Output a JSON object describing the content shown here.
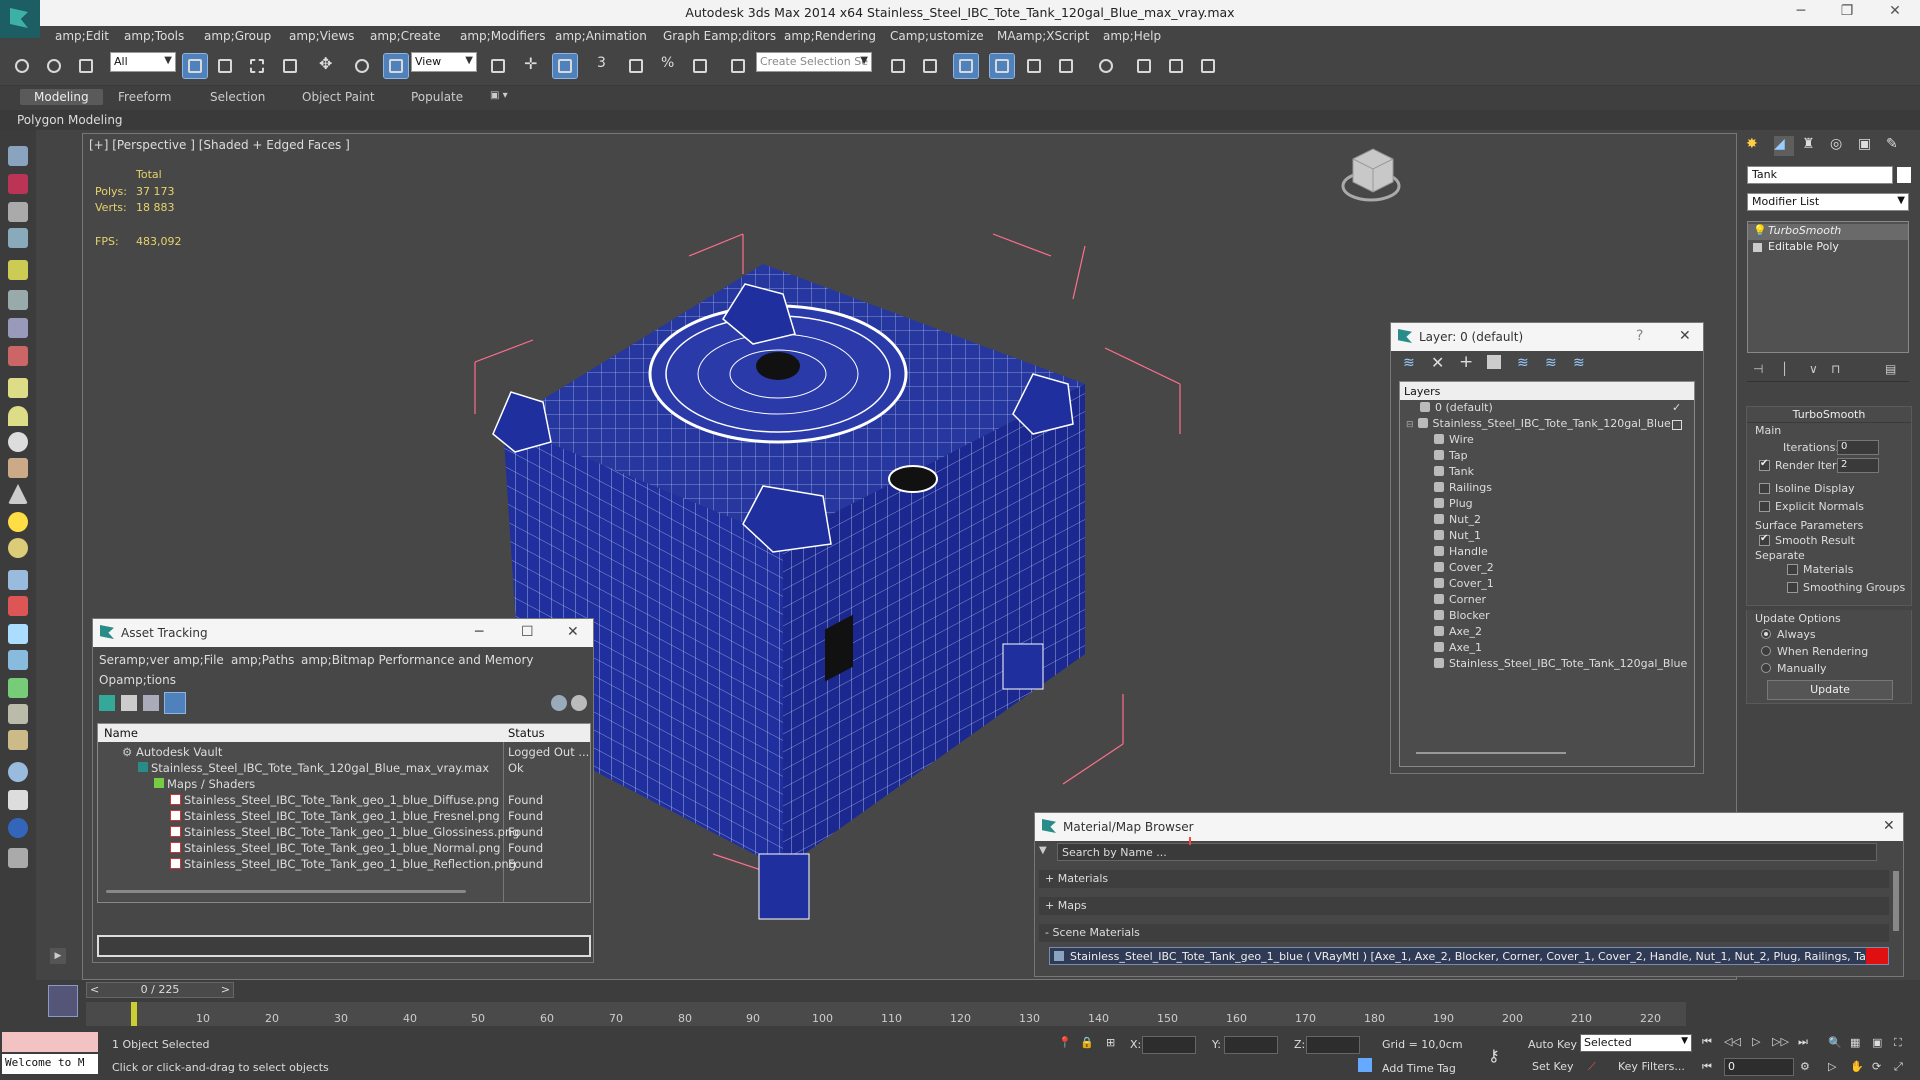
{
  "window": {
    "title": "Autodesk 3ds Max  2014 x64     Stainless_Steel_IBC_Tote_Tank_120gal_Blue_max_vray.max"
  },
  "menu": [
    "amp;Edit",
    "amp;Tools",
    "amp;Group",
    "amp;Views",
    "amp;Create",
    "amp;Modifiers",
    "amp;Animation",
    "Graph Eamp;ditors",
    "amp;Rendering",
    "Camp;ustomize",
    "MAamp;XScript",
    "amp;Help"
  ],
  "toolbar": {
    "filter_value": "All",
    "refcoord_value": "View",
    "selection_set_placeholder": "Create Selection Se"
  },
  "ribbon": {
    "tabs": [
      "Modeling",
      "Freeform",
      "Selection",
      "Object Paint",
      "Populate"
    ],
    "active_tab": "Modeling",
    "sub_label": "Polygon Modeling"
  },
  "viewport": {
    "label": "[+] [Perspective ] [Shaded + Edged Faces ]",
    "stats": {
      "total_label": "Total",
      "polys_label": "Polys:",
      "polys_value": "37 173",
      "verts_label": "Verts:",
      "verts_value": "18 883",
      "fps_label": "FPS:",
      "fps_value": "483,092"
    },
    "colors": {
      "mesh": "#1f2f9e",
      "wire": "#ffffff",
      "bbox": "#ff6f8d",
      "bg": "#474747"
    }
  },
  "command_panel": {
    "object_name": "Tank",
    "modifier_list": "Modifier List",
    "stack": [
      "TurboSmooth",
      "Editable Poly"
    ],
    "turbosmooth": {
      "title": "TurboSmooth",
      "main_label": "Main",
      "iterations_label": "Iterations:",
      "iterations_value": "0",
      "render_iters_label": "Render Iters:",
      "render_iters_value": "2",
      "render_iters_checked": true,
      "isoline_label": "Isoline Display",
      "explicit_label": "Explicit Normals",
      "surface_label": "Surface Parameters",
      "smooth_label": "Smooth Result",
      "separate_label": "Separate",
      "materials_label": "Materials",
      "smoothing_label": "Smoothing Groups",
      "update_options_label": "Update Options",
      "always_label": "Always",
      "when_rendering_label": "When Rendering",
      "manually_label": "Manually",
      "update_button": "Update"
    }
  },
  "asset_tracking": {
    "title": "Asset Tracking",
    "menu_line1": [
      "Seramp;ver",
      "amp;File",
      "amp;Paths",
      "amp;Bitmap Performance and Memory"
    ],
    "menu_line2": "Opamp;tions",
    "columns": [
      "Name",
      "Status"
    ],
    "rows": [
      {
        "name": "Autodesk Vault",
        "status": "Logged Out ..."
      },
      {
        "name": "Stainless_Steel_IBC_Tote_Tank_120gal_Blue_max_vray.max",
        "status": "Ok"
      },
      {
        "name": "Maps / Shaders",
        "status": ""
      },
      {
        "name": "Stainless_Steel_IBC_Tote_Tank_geo_1_blue_Diffuse.png",
        "status": "Found"
      },
      {
        "name": "Stainless_Steel_IBC_Tote_Tank_geo_1_blue_Fresnel.png",
        "status": "Found"
      },
      {
        "name": "Stainless_Steel_IBC_Tote_Tank_geo_1_blue_Glossiness.png",
        "status": "Found"
      },
      {
        "name": "Stainless_Steel_IBC_Tote_Tank_geo_1_blue_Normal.png",
        "status": "Found"
      },
      {
        "name": "Stainless_Steel_IBC_Tote_Tank_geo_1_blue_Reflection.png",
        "status": "Found"
      }
    ]
  },
  "layer_window": {
    "title": "Layer: 0 (default)",
    "help": "?",
    "header": "Layers",
    "rows": [
      "0 (default)",
      "Stainless_Steel_IBC_Tote_Tank_120gal_Blue",
      "Wire",
      "Tap",
      "Tank",
      "Railings",
      "Plug",
      "Nut_2",
      "Nut_1",
      "Handle",
      "Cover_2",
      "Cover_1",
      "Corner",
      "Blocker",
      "Axe_2",
      "Axe_1",
      "Stainless_Steel_IBC_Tote_Tank_120gal_Blue"
    ]
  },
  "material_browser": {
    "title": "Material/Map Browser",
    "search_placeholder": "Search by Name ...",
    "sections": [
      "+ Materials",
      "+ Maps",
      "- Scene Materials"
    ],
    "scene_material": "Stainless_Steel_IBC_Tote_Tank_geo_1_blue  ( VRayMtl )  [Axe_1, Axe_2, Blocker, Corner, Cover_1, Cover_2, Handle, Nut_1, Nut_2, Plug, Railings, Tank, Tap,..."
  },
  "timeline": {
    "frame_counter": "0 / 225",
    "ticks": [
      "10",
      "20",
      "30",
      "40",
      "50",
      "60",
      "70",
      "80",
      "90",
      "100",
      "110",
      "120",
      "130",
      "140",
      "150",
      "160",
      "170",
      "180",
      "190",
      "200",
      "210",
      "220"
    ]
  },
  "status": {
    "script_listener": "Welcome to M",
    "objects_selected": "1 Object Selected",
    "prompt": "Click or click-and-drag to select objects",
    "x_label": "X:",
    "y_label": "Y:",
    "z_label": "Z:",
    "grid": "Grid = 10,0cm",
    "auto_key": "Auto Key",
    "set_key": "Set Key",
    "selected_value": "Selected",
    "key_filters": "Key Filters...",
    "add_time_tag": "Add Time Tag",
    "frame_value": "0"
  }
}
